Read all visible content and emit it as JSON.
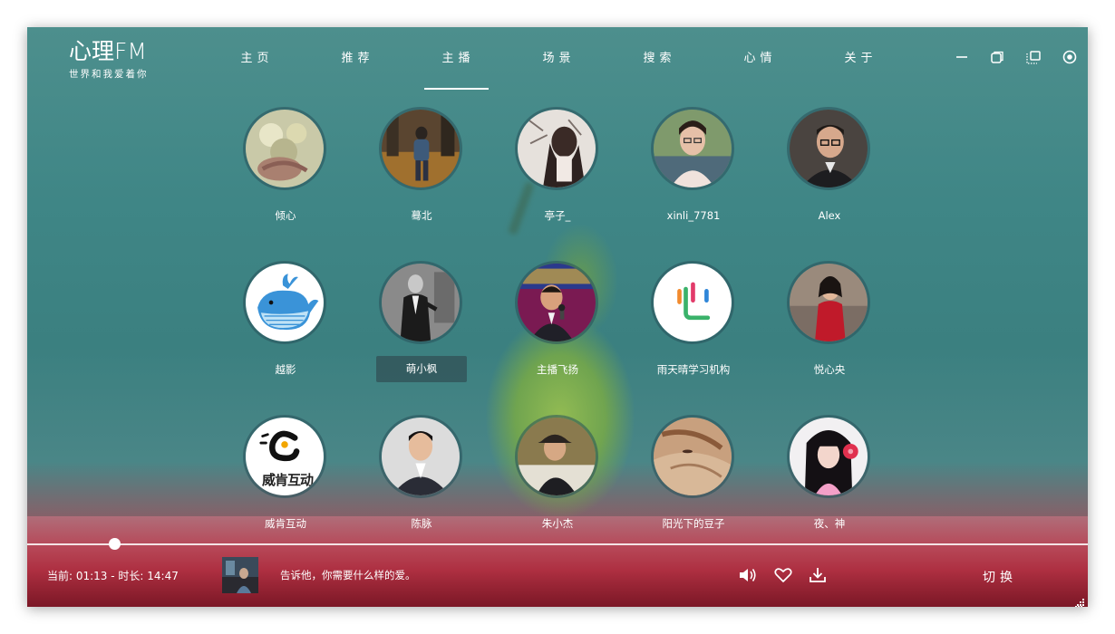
{
  "app": {
    "title": "心理FM",
    "subtitle": "世界和我爱着你"
  },
  "nav": {
    "items": [
      "主页",
      "推荐",
      "主播",
      "场景",
      "搜索",
      "心情",
      "关于"
    ],
    "active_index": 2
  },
  "window_controls": [
    "minimize-icon",
    "restore-icon",
    "compact-mode-icon",
    "record-icon"
  ],
  "artists": [
    {
      "name": "倾心",
      "avatar": "flowers-hands-icon"
    },
    {
      "name": "蓦北",
      "avatar": "walking-man-icon"
    },
    {
      "name": "亭子_",
      "avatar": "girl-back-icon"
    },
    {
      "name": "xinli_7781",
      "avatar": "woman-glasses-icon"
    },
    {
      "name": "Alex",
      "avatar": "man-glasses-icon"
    },
    {
      "name": "越影",
      "avatar": "whale-icon"
    },
    {
      "name": "萌小枫",
      "avatar": "man-suit-icon"
    },
    {
      "name": "主播飞扬",
      "avatar": "host-microphone-icon"
    },
    {
      "name": "雨天晴学习机构",
      "avatar": "voice-logo-icon"
    },
    {
      "name": "悦心央",
      "avatar": "woman-red-dress-icon"
    },
    {
      "name": "威肯互动",
      "avatar": "weiken-logo-icon",
      "logo_text": "威肯互动"
    },
    {
      "name": "陈脉",
      "avatar": "man-portrait-icon"
    },
    {
      "name": "朱小杰",
      "avatar": "man-hat-icon"
    },
    {
      "name": "阳光下的豆子",
      "avatar": "sleeping-girl-icon"
    },
    {
      "name": "夜、神",
      "avatar": "girl-flower-icon"
    }
  ],
  "selected_artist_index": 6,
  "player": {
    "time_text": "当前: 01:13 - 时长: 14:47",
    "current": "01:13",
    "duration": "14:47",
    "progress": 0.0823,
    "track_title": "告诉他，你需要什么样的爱。",
    "switch_label": "切换",
    "controls": [
      "volume-icon",
      "heart-icon",
      "download-icon"
    ]
  },
  "colors": {
    "accent": "#ffffff",
    "background_teal": "#3f8686",
    "background_red": "#a84b57"
  }
}
